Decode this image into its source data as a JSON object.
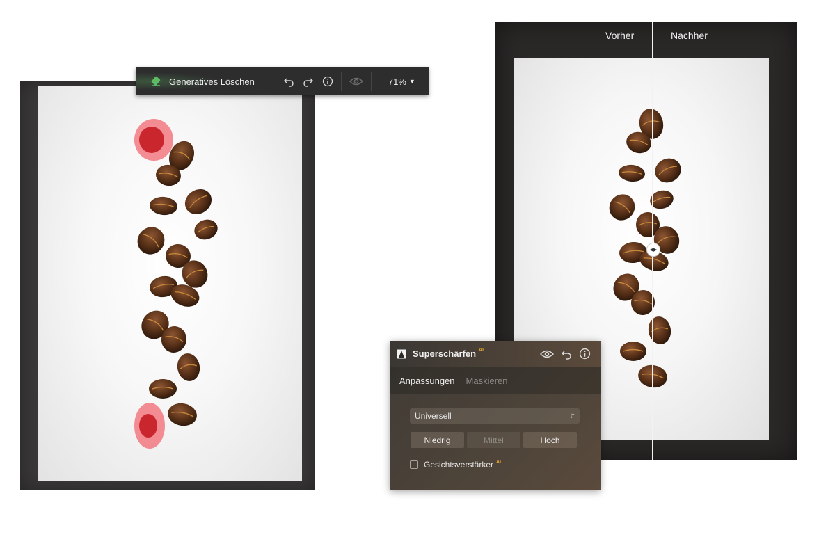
{
  "toolbar": {
    "tool_icon": "eraser-icon",
    "tool_label": "Generatives Löschen",
    "undo_icon": "undo-icon",
    "redo_icon": "redo-icon",
    "info_icon": "info-icon",
    "eye_icon": "eye-icon",
    "zoom_label": "71%",
    "zoom_icon": "chevron-down-icon",
    "accent_color": "#5dbb63"
  },
  "compare": {
    "before_label": "Vorher",
    "after_label": "Nachher",
    "handle_icon": "split-arrows-icon"
  },
  "sharpen_panel": {
    "title": "Superschärfen",
    "ai_badge": "AI",
    "ai_color": "#e0a030",
    "tabs": [
      {
        "label": "Anpassungen",
        "active": true
      },
      {
        "label": "Maskieren",
        "active": false
      }
    ],
    "mode_select": {
      "value": "Universell"
    },
    "strength_buttons": [
      {
        "label": "Niedrig",
        "enabled": true
      },
      {
        "label": "Mittel",
        "enabled": false
      },
      {
        "label": "Hoch",
        "enabled": true
      }
    ],
    "face_enhancer": {
      "label": "Gesichtsverstärker",
      "ai_badge": "AI",
      "checked": false
    }
  }
}
